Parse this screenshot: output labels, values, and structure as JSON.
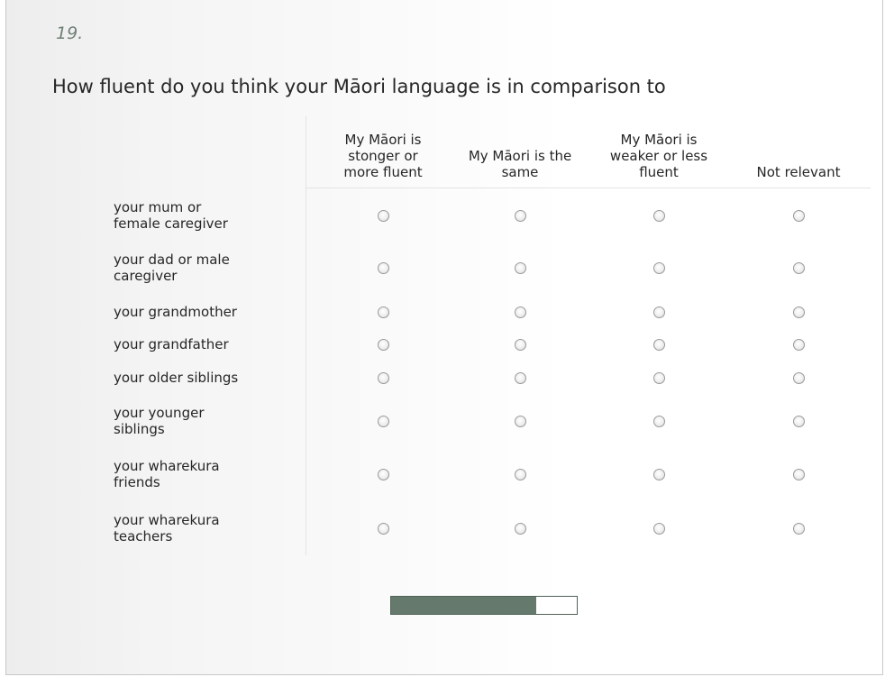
{
  "question": {
    "number": "19.",
    "text": "How fluent do you think your Māori language is in comparison to"
  },
  "columns": [
    {
      "label": "My Māori is\nstonger or\nmore fluent"
    },
    {
      "label": "My Māori is the\nsame"
    },
    {
      "label": "My Māori is\nweaker or less\nfluent"
    },
    {
      "label": "Not relevant"
    }
  ],
  "rows": [
    {
      "label": "your mum or\nfemale caregiver"
    },
    {
      "label": "your dad or male\ncaregiver"
    },
    {
      "label": "your grandmother"
    },
    {
      "label": "your grandfather"
    },
    {
      "label": "your older siblings"
    },
    {
      "label": "your younger\nsiblings"
    },
    {
      "label": "your wharekura\nfriends"
    },
    {
      "label": "your wharekura\nteachers"
    }
  ],
  "progress": {
    "fraction": 0.78
  },
  "colors": {
    "accent": "#66796d",
    "question_number": "#6f8277"
  }
}
